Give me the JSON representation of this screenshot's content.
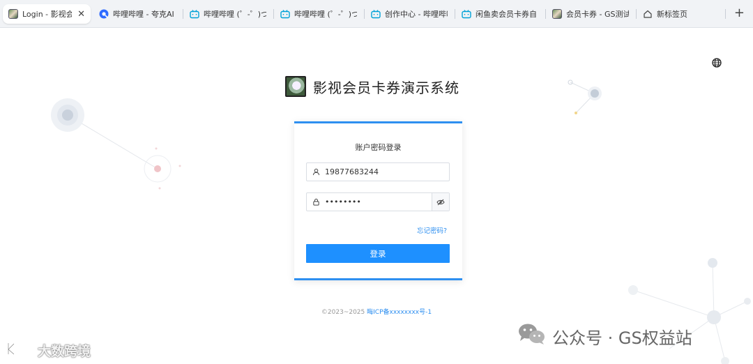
{
  "browser": {
    "tabs": [
      {
        "title": "Login - 影视会",
        "icon": "avatar-favicon",
        "active": true
      },
      {
        "title": "哔哩哔哩 - 夸克AI",
        "icon": "quark-ai-icon"
      },
      {
        "title": "哔哩哔哩 (゜-゜)つ",
        "icon": "bilibili-icon"
      },
      {
        "title": "哔哩哔哩 (゜-゜)つ",
        "icon": "bilibili-icon"
      },
      {
        "title": "创作中心 - 哔哩哔哩",
        "icon": "bilibili-icon"
      },
      {
        "title": "闲鱼卖会员卡券自",
        "icon": "bilibili-icon"
      },
      {
        "title": "会员卡券 - GS测试",
        "icon": "avatar-favicon"
      },
      {
        "title": "新标签页",
        "icon": "home-icon"
      }
    ],
    "close_symbol": "✕",
    "new_tab_symbol": "+"
  },
  "header": {
    "brand_title": "影视会员卡券演示系统",
    "language_icon": "globe-icon"
  },
  "login": {
    "title": "账户密码登录",
    "username_value": "19877683244",
    "password_value": "••••••••",
    "forgot_label": "忘记密码?",
    "submit_label": "登录"
  },
  "footer": {
    "copyright": "©2023~2025 ",
    "icp": "晦ICP备xxxxxxxx号-1"
  },
  "watermarks": {
    "left": "大数跨境",
    "right": "公众号 · GS权益站"
  },
  "colors": {
    "accent": "#1e90ff",
    "card_border": "#2e8ff0"
  }
}
